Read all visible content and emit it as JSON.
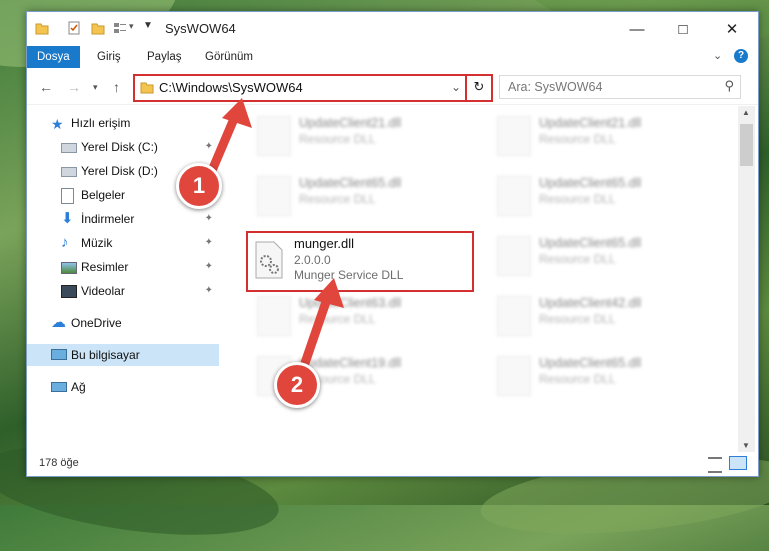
{
  "window": {
    "title": "SysWOW64"
  },
  "ribbon": {
    "tabs": [
      {
        "label": "Dosya",
        "active": true
      },
      {
        "label": "Giriş",
        "active": false
      },
      {
        "label": "Paylaş",
        "active": false
      },
      {
        "label": "Görünüm",
        "active": false
      }
    ]
  },
  "address": {
    "path": "C:\\Windows\\SysWOW64"
  },
  "search": {
    "placeholder": "Ara: SysWOW64"
  },
  "nav": {
    "quick_access": "Hızlı erişim",
    "items": [
      {
        "label": "Yerel Disk (C:)",
        "icon": "drive-icon"
      },
      {
        "label": "Yerel Disk (D:)",
        "icon": "drive-icon"
      },
      {
        "label": "Belgeler",
        "icon": "documents-icon"
      },
      {
        "label": "İndirmeler",
        "icon": "downloads-icon"
      },
      {
        "label": "Müzik",
        "icon": "music-icon"
      },
      {
        "label": "Resimler",
        "icon": "pictures-icon"
      },
      {
        "label": "Videolar",
        "icon": "videos-icon"
      }
    ],
    "onedrive": "OneDrive",
    "this_pc": "Bu bilgisayar",
    "network": "Ağ"
  },
  "files": {
    "left": [
      {
        "name": "UpdateClient21.dll",
        "desc": "Resource DLL"
      },
      {
        "name": "UpdateClient65.dll",
        "desc": "Resource DLL"
      },
      {
        "name": "UpdateClient63.dll",
        "desc": "Resource DLL"
      },
      {
        "name": "UpdateClient19.dll",
        "desc": "Resource DLL"
      }
    ],
    "right": [
      {
        "name": "UpdateClient21.dll",
        "desc": "Resource DLL"
      },
      {
        "name": "UpdateClient65.dll",
        "desc": "Resource DLL"
      },
      {
        "name": "UpdateClient65.dll",
        "desc": "Resource DLL"
      },
      {
        "name": "UpdateClient42.dll",
        "desc": "Resource DLL"
      },
      {
        "name": "UpdateClient65.dll",
        "desc": "Resource DLL"
      }
    ],
    "highlighted": {
      "name": "munger.dll",
      "version": "2.0.0.0",
      "desc": "Munger Service DLL"
    }
  },
  "status": {
    "count": "178 öğe"
  },
  "annotations": {
    "step1": "1",
    "step2": "2"
  },
  "colors": {
    "accent": "#1979ca",
    "highlight": "#d32f2f"
  }
}
